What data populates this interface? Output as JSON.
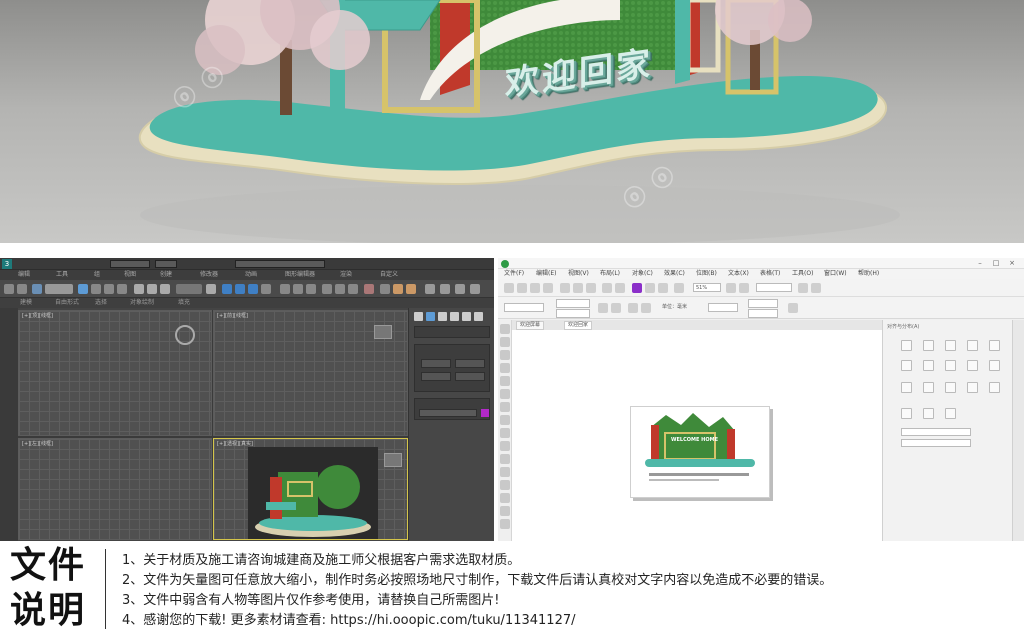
{
  "render": {
    "title": "欢迎回家"
  },
  "app3d": {
    "menus": [
      "编辑",
      "工具",
      "组",
      "视图",
      "创建",
      "修改器",
      "动画",
      "图形编辑器",
      "渲染",
      "自定义"
    ],
    "tabs": [
      "建模",
      "自由形式",
      "选择",
      "对象绘制",
      "填充"
    ],
    "viewports": [
      "[+][顶][线框]",
      "[+][前][线框]",
      "[+][左][线框]",
      "[+][透视][真实]"
    ]
  },
  "appDraw": {
    "menus": [
      "文件(F)",
      "编辑(E)",
      "视图(V)",
      "布局(L)",
      "对象(C)",
      "效果(C)",
      "位图(B)",
      "文本(X)",
      "表格(T)",
      "工具(O)",
      "窗口(W)",
      "帮助(H)"
    ],
    "tabs": [
      "欢迎屏幕",
      "欢迎回家"
    ],
    "page_text": "WELCOME HOME",
    "docker_title": "对齐与分布(A)",
    "unit_label": "单位：毫米",
    "zoom": "51%"
  },
  "info": {
    "heading_line1": "文件",
    "heading_line2": "说明",
    "lines": [
      "1、关于材质及施工请咨询城建商及施工师父根据客户需求选取材质。",
      "2、文件为矢量图可任意放大缩小，制作时务必按照场地尺寸制作，下载文件后请认真校对文字内容以免造成不必要的错误。",
      "3、文件中弱含有人物等图片仅作参考使用，请替换自己所需图片!",
      "4、感谢您的下载! 更多素材请查看: https://hi.ooopic.com/tuku/11341127/"
    ]
  },
  "colors": {
    "teal": "#4fb8a8",
    "cream": "#ece5c8",
    "gold": "#d6c36a",
    "red": "#c0392b",
    "green": "#3f8a3a"
  }
}
